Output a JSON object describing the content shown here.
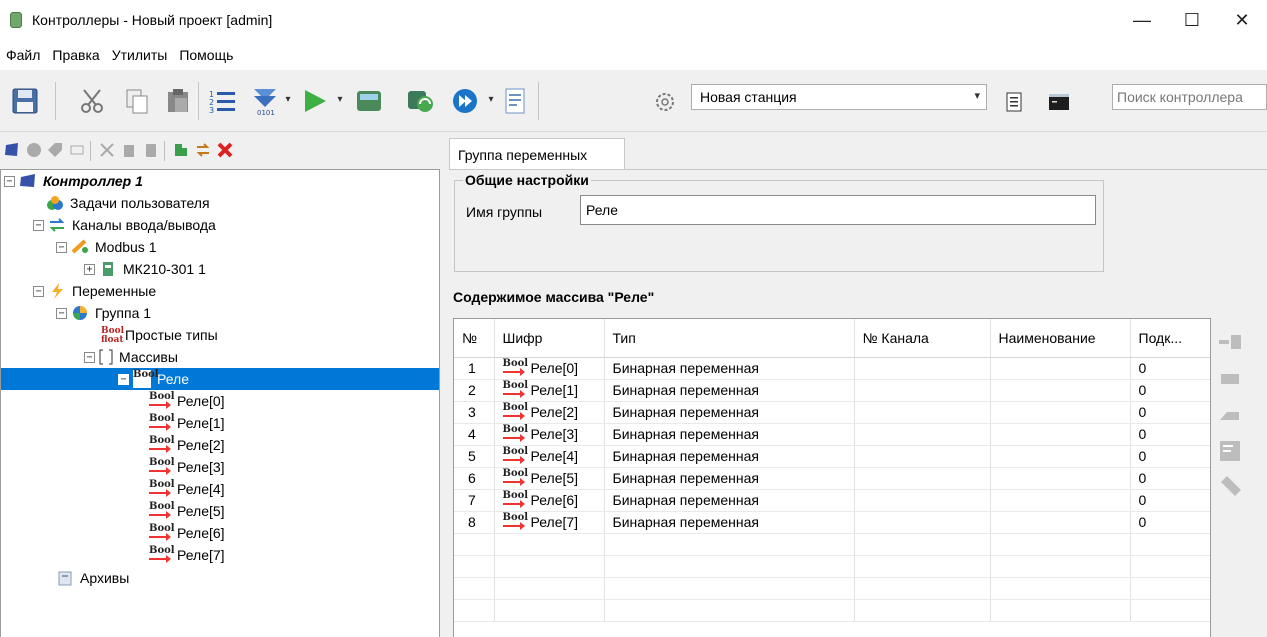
{
  "window": {
    "title": "Контроллеры - Новый проект [admin]",
    "minimize": "—",
    "maximize": "☐",
    "close": "✕"
  },
  "menu": [
    "Файл",
    "Правка",
    "Утилиты",
    "Помощь"
  ],
  "toolbar": {
    "station": "Новая станция",
    "search_placeholder": "Поиск контроллера",
    "icons": [
      "save-icon",
      "cut-icon",
      "copy-icon",
      "paste-icon",
      "list-icon",
      "download-icon",
      "run-icon",
      "compile-icon",
      "sync-icon",
      "step-icon",
      "document-icon",
      "settings-icon",
      "report-icon",
      "console-icon"
    ]
  },
  "tree": {
    "controller": "Контроллер 1",
    "user_tasks": "Задачи пользователя",
    "io_channels": "Каналы ввода/вывода",
    "modbus": "Modbus 1",
    "module": "МК210-301 1",
    "variables": "Переменные",
    "group": "Группа 1",
    "simple_types": "Простые типы",
    "arrays": "Массивы",
    "array": "Реле",
    "items": [
      "Реле[0]",
      "Реле[1]",
      "Реле[2]",
      "Реле[3]",
      "Реле[4]",
      "Реле[5]",
      "Реле[6]",
      "Реле[7]"
    ],
    "archives": "Архивы",
    "bool_label": "Bool",
    "float_label": "float"
  },
  "tab": "Группа переменных",
  "general": {
    "legend": "Общие настройки",
    "name_label": "Имя группы",
    "name_value": "Реле"
  },
  "array_title": "Содержимое массива \"Реле\"",
  "grid": {
    "columns": [
      "№",
      "Шифр",
      "Тип",
      "№ Канала",
      "Наименование",
      "Подк..."
    ],
    "rows": [
      {
        "n": "1",
        "code": "Реле[0]",
        "type": "Бинарная переменная",
        "channel": "",
        "name": "",
        "conn": "0"
      },
      {
        "n": "2",
        "code": "Реле[1]",
        "type": "Бинарная переменная",
        "channel": "",
        "name": "",
        "conn": "0"
      },
      {
        "n": "3",
        "code": "Реле[2]",
        "type": "Бинарная переменная",
        "channel": "",
        "name": "",
        "conn": "0"
      },
      {
        "n": "4",
        "code": "Реле[3]",
        "type": "Бинарная переменная",
        "channel": "",
        "name": "",
        "conn": "0"
      },
      {
        "n": "5",
        "code": "Реле[4]",
        "type": "Бинарная переменная",
        "channel": "",
        "name": "",
        "conn": "0"
      },
      {
        "n": "6",
        "code": "Реле[5]",
        "type": "Бинарная переменная",
        "channel": "",
        "name": "",
        "conn": "0"
      },
      {
        "n": "7",
        "code": "Реле[6]",
        "type": "Бинарная переменная",
        "channel": "",
        "name": "",
        "conn": "0"
      },
      {
        "n": "8",
        "code": "Реле[7]",
        "type": "Бинарная переменная",
        "channel": "",
        "name": "",
        "conn": "0"
      }
    ]
  },
  "colors": {
    "selection": "#0078d7",
    "bool_arrow": "#e33333"
  }
}
